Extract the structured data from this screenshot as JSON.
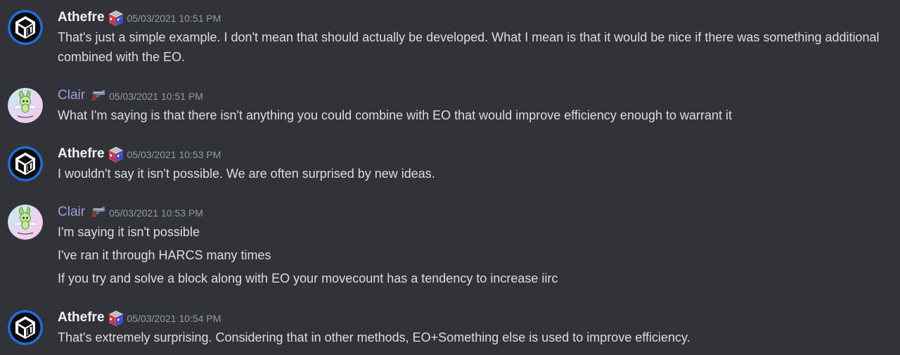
{
  "messages": [
    {
      "author": "Athefre",
      "author_color": "#f2f3f5",
      "avatar_icon": "cube-logo-avatar",
      "badge_icon": "rubiks-cube-icon",
      "timestamp": "05/03/2021 10:51 PM",
      "lines": [
        "That's just a simple example. I don't mean that should actually be developed. What I mean is that it would be nice if there was something additional combined with the EO."
      ]
    },
    {
      "author": "Clair",
      "author_color": "#a29ce3",
      "avatar_icon": "celebi-avatar",
      "badge_icon": "gun-icon",
      "timestamp": "05/03/2021 10:51 PM",
      "lines": [
        "What I'm saying is that there isn't anything you could combine with EO that would improve efficiency enough to warrant it"
      ]
    },
    {
      "author": "Athefre",
      "author_color": "#f2f3f5",
      "avatar_icon": "cube-logo-avatar",
      "badge_icon": "rubiks-cube-icon",
      "timestamp": "05/03/2021 10:53 PM",
      "lines": [
        "I wouldn't say it isn't possible. We are often surprised by new ideas."
      ]
    },
    {
      "author": "Clair",
      "author_color": "#a29ce3",
      "avatar_icon": "celebi-avatar",
      "badge_icon": "gun-icon",
      "timestamp": "05/03/2021 10:53 PM",
      "lines": [
        "I'm saying it isn't possible",
        "I've ran it through HARCS many times",
        "If you try and solve a block along with EO your movecount has a tendency to increase iirc"
      ]
    },
    {
      "author": "Athefre",
      "author_color": "#f2f3f5",
      "avatar_icon": "cube-logo-avatar",
      "badge_icon": "rubiks-cube-icon",
      "timestamp": "05/03/2021 10:54 PM",
      "lines": [
        "That's extremely surprising. Considering that in other methods, EO+Something else is used to improve efficiency."
      ]
    }
  ],
  "theme": {
    "background": "#313338",
    "text": "#dbdee1",
    "timestamp": "#949ba4"
  }
}
